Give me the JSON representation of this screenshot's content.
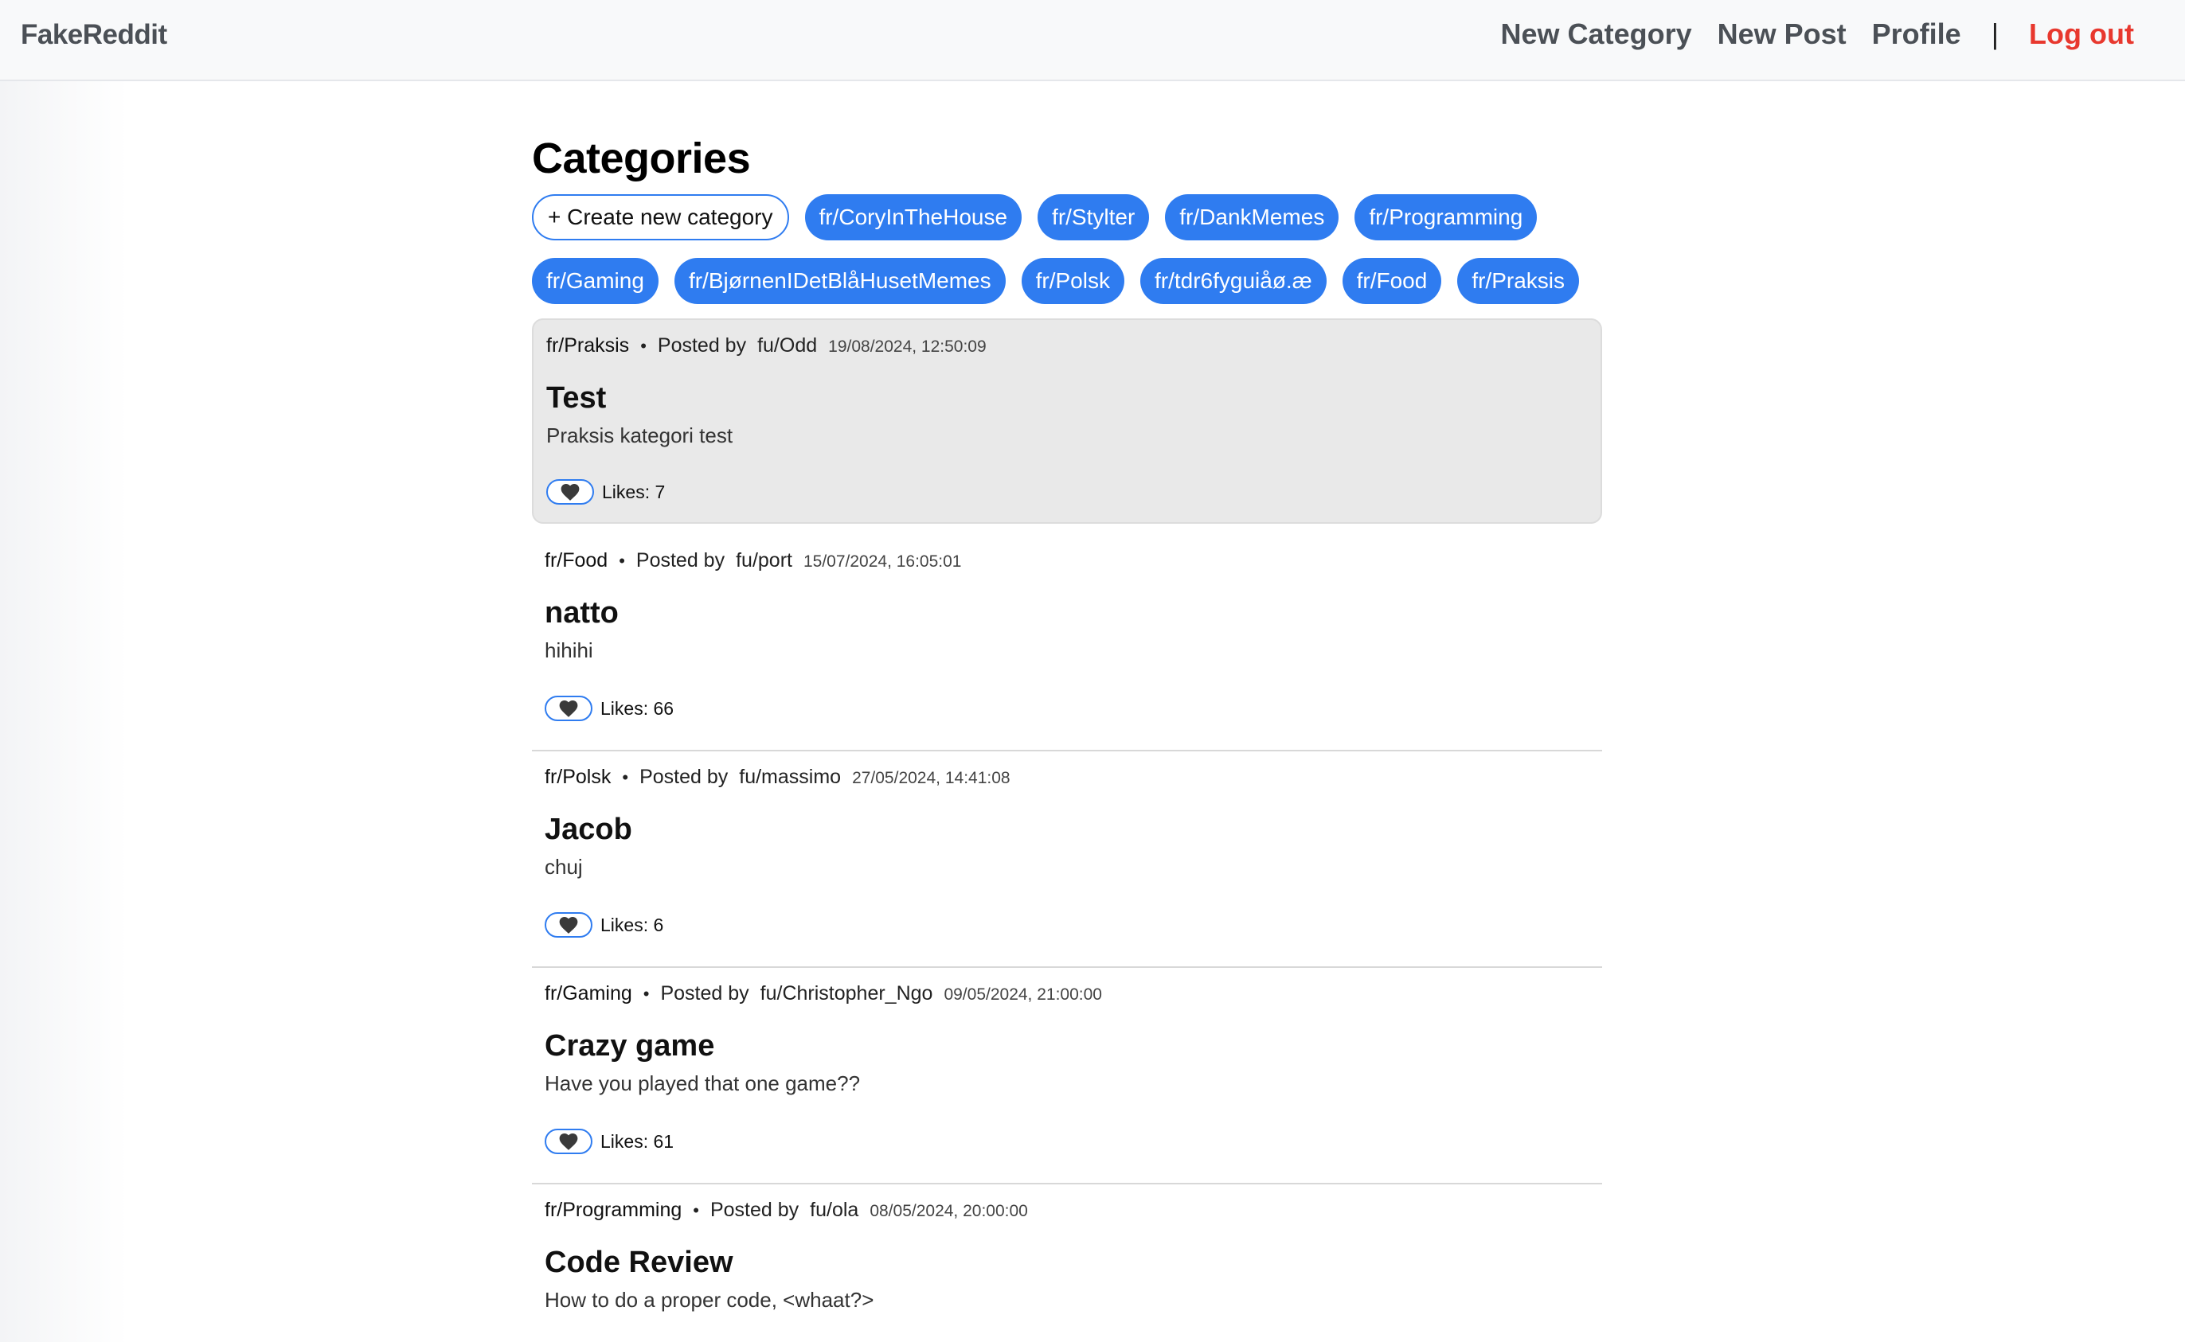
{
  "navbar": {
    "brand": "FakeReddit",
    "links": {
      "new_category": "New Category",
      "new_post": "New Post",
      "profile": "Profile",
      "separator": "|",
      "logout": "Log out"
    }
  },
  "categories": {
    "title": "Categories",
    "create_label": "+ Create new category",
    "items": [
      "fr/CoryInTheHouse",
      "fr/Stylter",
      "fr/DankMemes",
      "fr/Programming",
      "fr/Gaming",
      "fr/BjørnenIDetBlåHusetMemes",
      "fr/Polsk",
      "fr/tdr6fyguiåø.æ",
      "fr/Food",
      "fr/Praksis"
    ]
  },
  "posts_common": {
    "posted_by": "Posted by",
    "dot": "•",
    "like_icon": "heart-icon"
  },
  "posts": [
    {
      "category": "fr/Praksis",
      "author": "fu/Odd",
      "date": "19/08/2024, 12:50:09",
      "title": "Test",
      "body": "Praksis kategori test",
      "likes": "Likes: 7"
    },
    {
      "category": "fr/Food",
      "author": "fu/port",
      "date": "15/07/2024, 16:05:01",
      "title": "natto",
      "body": "hihihi",
      "likes": "Likes: 66"
    },
    {
      "category": "fr/Polsk",
      "author": "fu/massimo",
      "date": "27/05/2024, 14:41:08",
      "title": "Jacob",
      "body": "chuj",
      "likes": "Likes: 6"
    },
    {
      "category": "fr/Gaming",
      "author": "fu/Christopher_Ngo",
      "date": "09/05/2024, 21:00:00",
      "title": "Crazy game",
      "body": "Have you played that one game??",
      "likes": "Likes: 61"
    },
    {
      "category": "fr/Programming",
      "author": "fu/ola",
      "date": "08/05/2024, 20:00:00",
      "title": "Code Review",
      "body": "How to do a proper code, <whaat?>",
      "likes": ""
    }
  ],
  "colors": {
    "accent": "#2f7cf0",
    "logout": "#e8382e",
    "nav_text": "#4b5056"
  }
}
